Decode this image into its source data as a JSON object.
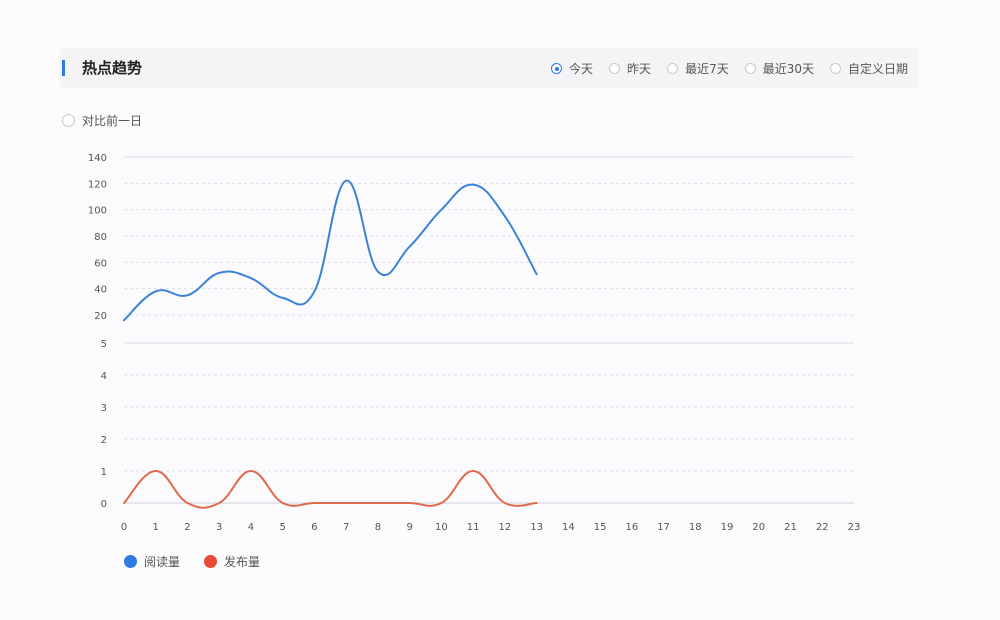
{
  "header": {
    "title": "热点趋势",
    "ranges": [
      {
        "label": "今天",
        "selected": true
      },
      {
        "label": "昨天",
        "selected": false
      },
      {
        "label": "最近7天",
        "selected": false
      },
      {
        "label": "最近30天",
        "selected": false
      },
      {
        "label": "自定义日期",
        "selected": false
      }
    ]
  },
  "compare": {
    "label": "对比前一日",
    "selected": false
  },
  "colors": {
    "accent": "#2f7ae5",
    "series_blue": "#3b82d6",
    "series_red": "#e06a4c"
  },
  "chart_data": {
    "type": "line",
    "x": [
      0,
      1,
      2,
      3,
      4,
      5,
      6,
      7,
      8,
      9,
      10,
      11,
      12,
      13,
      14,
      15,
      16,
      17,
      18,
      19,
      20,
      21,
      22,
      23
    ],
    "upper_y_ticks": [
      20,
      40,
      60,
      80,
      100,
      120,
      140
    ],
    "lower_y_ticks": [
      0,
      1,
      2,
      3,
      4,
      5
    ],
    "series": [
      {
        "name": "阅读量",
        "color": "#3b82d6",
        "panel": "upper",
        "x": [
          0,
          1,
          2,
          3,
          4,
          5,
          6,
          7,
          8,
          9,
          10,
          11,
          12,
          13
        ],
        "values": [
          16,
          38,
          35,
          52,
          48,
          33,
          38,
          122,
          53,
          72,
          100,
          119,
          95,
          51
        ]
      },
      {
        "name": "发布量",
        "color": "#e06a4c",
        "panel": "lower",
        "x": [
          0,
          1,
          2,
          3,
          4,
          5,
          6,
          7,
          8,
          9,
          10,
          11,
          12,
          13
        ],
        "values": [
          0,
          1,
          0,
          0,
          1,
          0,
          0,
          0,
          0,
          0,
          0,
          1,
          0,
          0
        ]
      }
    ],
    "grid": true,
    "legend_position": "bottom-left"
  }
}
